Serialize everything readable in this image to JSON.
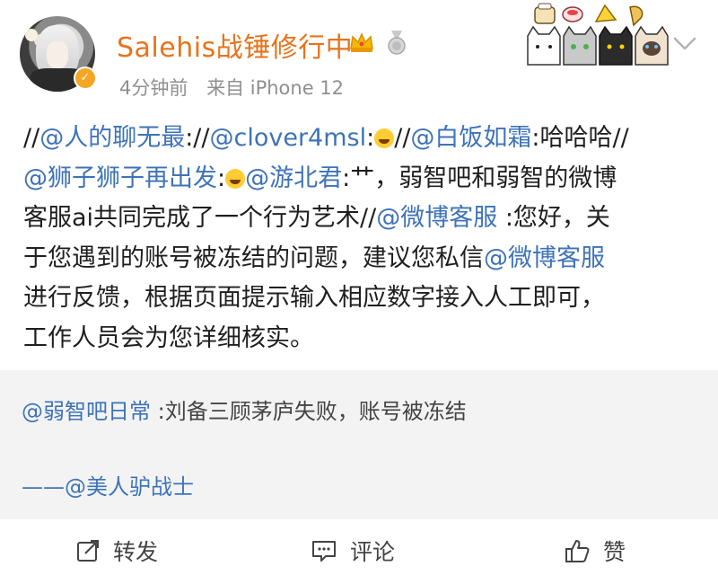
{
  "header": {
    "username": "Salehis战锤修行中",
    "time": "4分钟前",
    "source": "来自 iPhone 12",
    "icons": [
      "crown-icon",
      "medal-icon",
      "verified-badge-icon",
      "chevron-down-icon"
    ],
    "accent_color": "#e8731a"
  },
  "post": {
    "segments": [
      {
        "t": "//",
        "m": false
      },
      {
        "t": "@人的聊无最",
        "m": true
      },
      {
        "t": "://",
        "m": false
      },
      {
        "t": "@clover4msl",
        "m": true
      },
      {
        "t": ":",
        "m": false
      },
      {
        "emoji": "laughing-crying-emoji"
      },
      {
        "t": "//",
        "m": false
      },
      {
        "t": "@白饭如霜",
        "m": true
      },
      {
        "t": ":哈哈哈//",
        "m": false
      },
      {
        "br": true
      },
      {
        "t": "@狮子狮子再出发",
        "m": true
      },
      {
        "t": ":",
        "m": false
      },
      {
        "emoji": "grinning-emoji"
      },
      {
        "t": "@游北君",
        "m": true
      },
      {
        "t": ":艹，弱智吧和弱智的微博",
        "m": false
      },
      {
        "br": true
      },
      {
        "t": "客服ai共同完成了一个行为艺术//",
        "m": false
      },
      {
        "t": "@微博客服",
        "m": true
      },
      {
        "t": " :您好，关",
        "m": false
      },
      {
        "br": true
      },
      {
        "t": "于您遇到的账号被冻结的问题，建议您私信",
        "m": false
      },
      {
        "t": "@微博客服",
        "m": true
      },
      {
        "br": true
      },
      {
        "t": "进行反馈，根据页面提示输入相应数字接入人工即可，",
        "m": false
      },
      {
        "br": true
      },
      {
        "t": "工作人员会为您详细核实。",
        "m": false
      }
    ],
    "mention_color": "#3e73b8"
  },
  "quote": {
    "author": "@弱智吧日常",
    "text": " :刘备三顾茅庐失败，账号被冻结",
    "signature": "——@美人驴战士",
    "background": "#f3f3f3"
  },
  "actions": {
    "repost_label": "转发",
    "comment_label": "评论",
    "like_label": "赞"
  }
}
